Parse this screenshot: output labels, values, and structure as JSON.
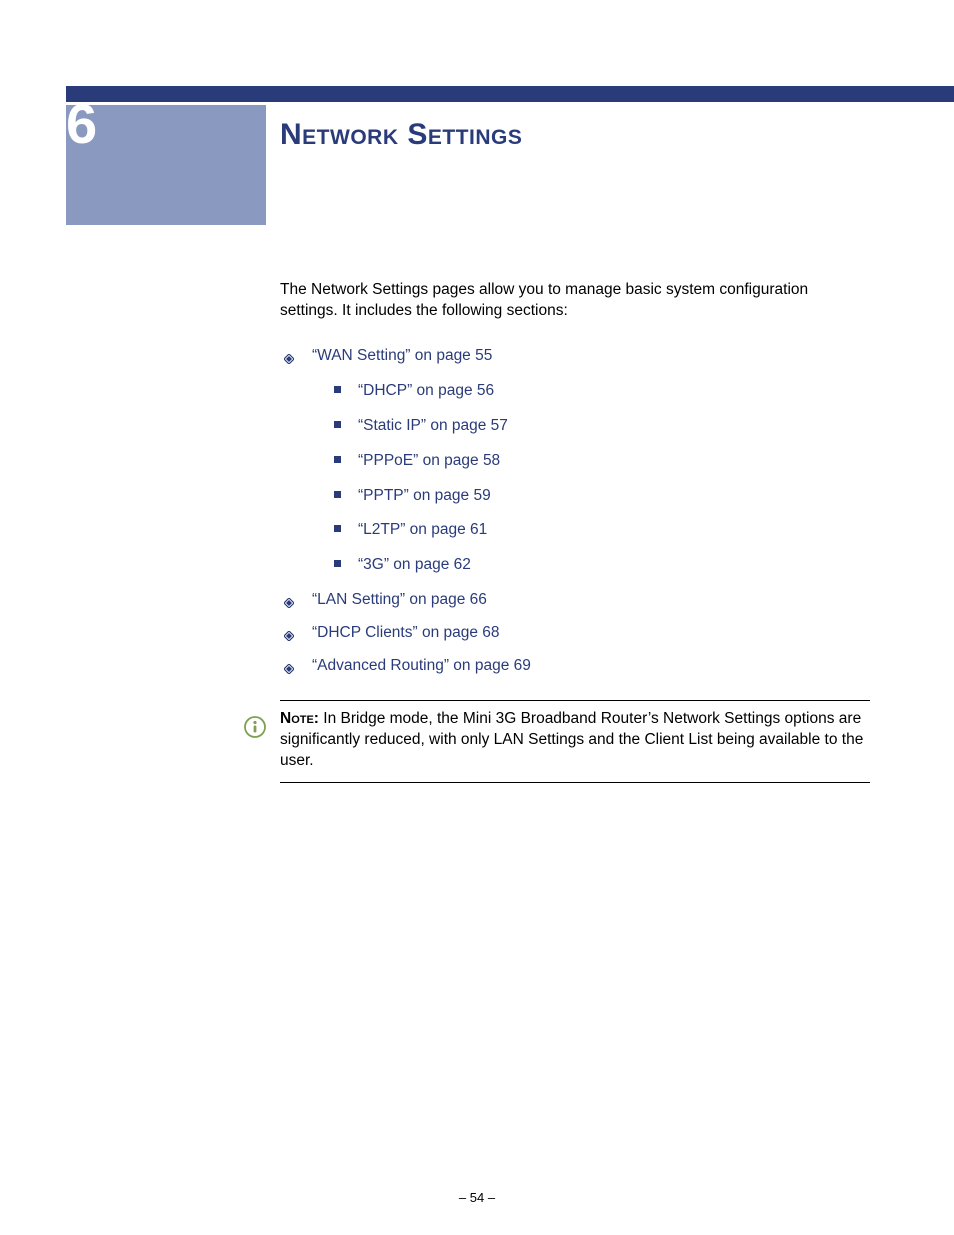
{
  "chapterNumber": "6",
  "chapterTitle": "Network Settings",
  "intro": "The Network Settings pages allow you to manage basic system configuration settings. It includes the following sections:",
  "links": {
    "wan": "“WAN Setting” on page 55",
    "dhcp": "“DHCP” on page 56",
    "staticip": "“Static IP” on page 57",
    "pppoe": "“PPPoE” on page 58",
    "pptp": "“PPTP” on page 59",
    "l2tp": "“L2TP” on page 61",
    "threeg": "“3G” on page 62",
    "lan": "“LAN Setting” on page 66",
    "dhcpclients": "“DHCP Clients” on page 68",
    "advrouting": "“Advanced Routing” on page 69"
  },
  "note": {
    "label": "Note:",
    "text": " In Bridge mode, the Mini 3G Broadband Router’s Network Settings options are significantly reduced, with only LAN Settings and the Client List being available to the user."
  },
  "pageNumberPrefix": "–  ",
  "pageNumber": "54",
  "pageNumberSuffix": "  –"
}
